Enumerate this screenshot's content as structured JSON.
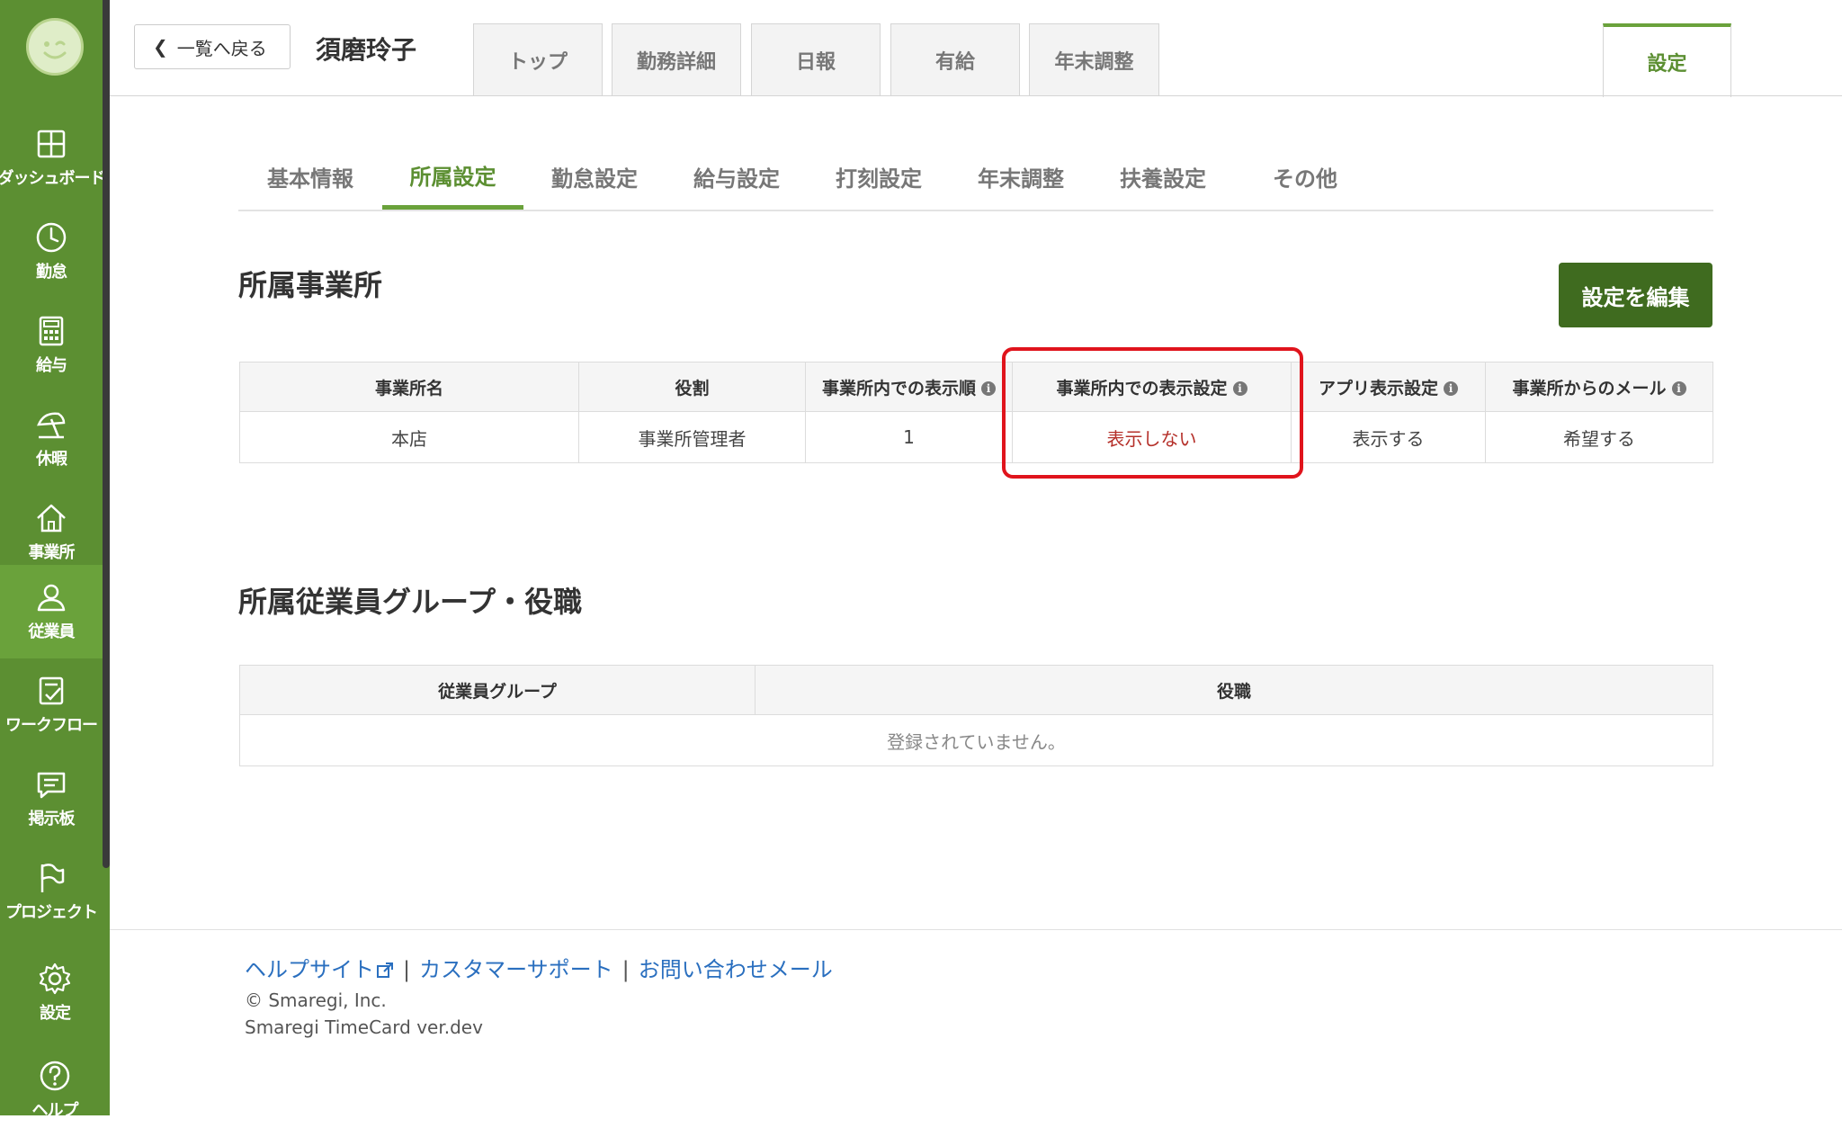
{
  "sidebar": {
    "items": [
      {
        "label": "ダッシュボード",
        "icon": "dashboard-icon"
      },
      {
        "label": "勤怠",
        "icon": "clock-icon"
      },
      {
        "label": "給与",
        "icon": "calculator-icon"
      },
      {
        "label": "休暇",
        "icon": "beach-umbrella-icon"
      },
      {
        "label": "事業所",
        "icon": "home-icon"
      },
      {
        "label": "従業員",
        "icon": "person-icon"
      },
      {
        "label": "ワークフロー",
        "icon": "workflow-icon"
      },
      {
        "label": "掲示板",
        "icon": "message-board-icon"
      },
      {
        "label": "プロジェクト",
        "icon": "flag-icon"
      },
      {
        "label": "設定",
        "icon": "gear-icon"
      },
      {
        "label": "ヘルプ",
        "icon": "help-icon"
      }
    ]
  },
  "header": {
    "back_label": "一覧へ戻る",
    "employee_name": "須磨玲子",
    "tabs": [
      "トップ",
      "勤務詳細",
      "日報",
      "有給",
      "年末調整"
    ],
    "settings_tab": "設定"
  },
  "sub_tabs": [
    "基本情報",
    "所属設定",
    "勤怠設定",
    "給与設定",
    "打刻設定",
    "年末調整",
    "扶養設定",
    "その他"
  ],
  "office_section": {
    "title": "所属事業所",
    "edit_button": "設定を編集",
    "columns": [
      "事業所名",
      "役割",
      "事業所内での表示順",
      "事業所内での表示設定",
      "アプリ表示設定",
      "事業所からのメール"
    ],
    "row": [
      "本店",
      "事業所管理者",
      "1",
      "表示しない",
      "表示する",
      "希望する"
    ]
  },
  "group_section": {
    "title": "所属従業員グループ・役職",
    "columns": [
      "従業員グループ",
      "役職"
    ],
    "empty_message": "登録されていません。"
  },
  "footer": {
    "help_site": "ヘルプサイト",
    "customer_support": "カスタマーサポート",
    "contact_mail": "お問い合わせメール",
    "separator": "|",
    "copyright": "© Smaregi, Inc.",
    "version": "Smaregi TimeCard ver.dev"
  },
  "colors": {
    "sidebar": "#5c8f32",
    "sidebar_active": "#6aa23b",
    "accent": "#5c8f32",
    "edit_button": "#3f6b1f",
    "highlight": "#e0141c",
    "link": "#2a6fbf"
  }
}
